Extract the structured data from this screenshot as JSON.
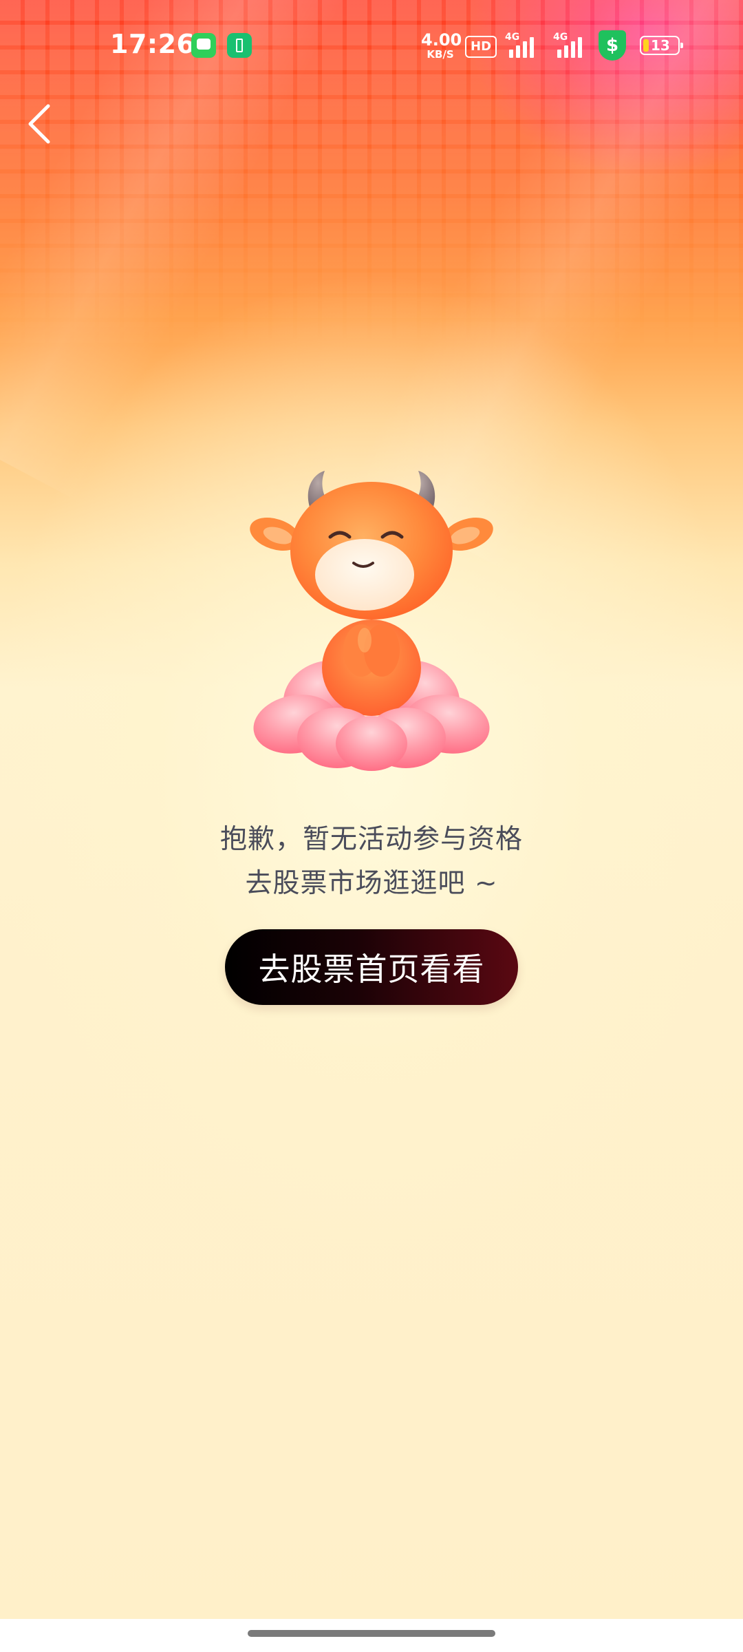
{
  "status_bar": {
    "time": "17:26",
    "net_speed_value": "4.00",
    "net_speed_unit": "KB/S",
    "hd_label": "HD",
    "signal_1_label": "4G",
    "signal_2_label": "4G",
    "shield_symbol": "$",
    "battery_level": "13"
  },
  "nav": {
    "back_icon": "chevron-left-icon"
  },
  "mascot": {
    "name": "bull-mascot"
  },
  "message": {
    "line1": "抱歉，暂无活动参与资格",
    "line2": "去股票市场逛逛吧 ~"
  },
  "cta": {
    "label": "去股票首页看看"
  },
  "colors": {
    "header_top": "#ff3a22",
    "background": "#fff2d2",
    "button_start": "#000000",
    "button_end": "#5a0812",
    "message_text": "#4a4c5a"
  }
}
